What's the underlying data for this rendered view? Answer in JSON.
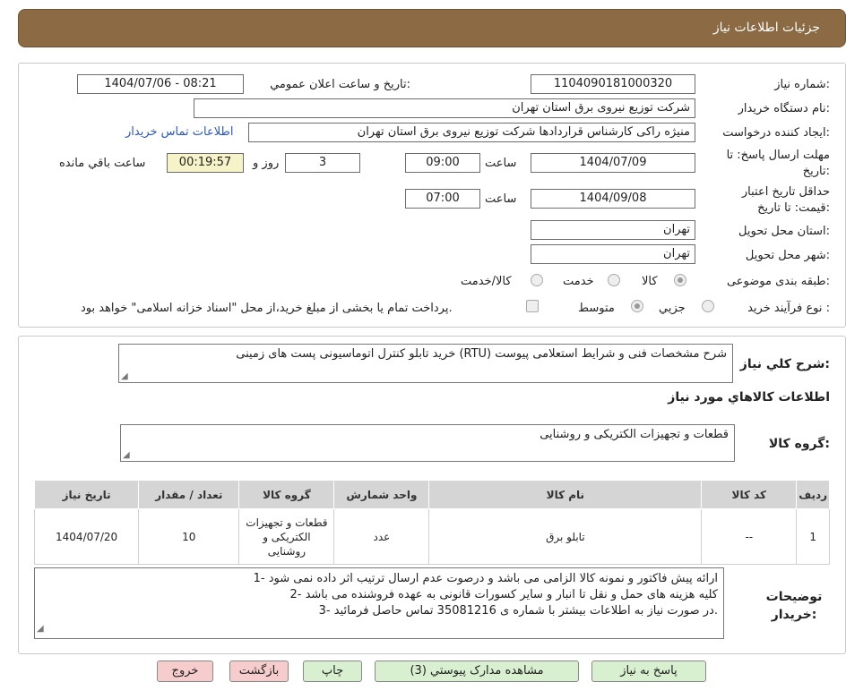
{
  "header": {
    "title": "جزئیات اطلاعات نیاز"
  },
  "fields": {
    "need_number_label": "شماره نیاز:",
    "need_number": "1104090181000320",
    "announce_label": "تاریخ و ساعت اعلان عمومي:",
    "announce_value": "1404/07/06 - 08:21",
    "buyer_org_label": "نام دستگاه خريدار:",
    "buyer_org": "شرکت توزیع نیروی برق استان تهران",
    "creator_label": "ايجاد كننده درخواست:",
    "creator": "منیژه راکی کارشناس قراردادها شرکت توزیع نیروی برق استان تهران",
    "contact_link": "اطلاعات تماس خريدار",
    "deadline_label": "مهلت ارسال پاسخ: تا تاريخ:",
    "deadline_date": "1404/07/09",
    "time_label": "ساعت",
    "deadline_time": "09:00",
    "days": "3",
    "days_label": "روز و",
    "remaining": "00:19:57",
    "remaining_label": "ساعت باقي مانده",
    "validity_label": "حداقل تاريخ اعتبار قيمت: تا تاريخ:",
    "validity_date": "1404/09/08",
    "validity_time_label": "ساعت",
    "validity_time": "07:00",
    "province_label": "استان محل تحويل:",
    "province": "تهران",
    "city_label": "شهر محل تحويل:",
    "city": "تهران",
    "category_label": "طبقه بندی موضوعی:",
    "category_options": [
      "کالا",
      "خدمت",
      "کالا/خدمت"
    ],
    "process_label": "نوع فرآيند خريد :",
    "process_options": [
      "جزيي",
      "متوسط"
    ],
    "process_note": "پرداخت تمام یا بخشی از مبلغ خرید،از محل \"اسناد خزانه اسلامی\" خواهد بود."
  },
  "summary": {
    "label": "شرح كلي نياز:",
    "text": "خرید تابلو کنترل اتوماسیونی پست های زمینی (RTU) شرح مشخصات فنی و شرایط استعلامی پیوست"
  },
  "goods": {
    "section_title": "اطلاعات كالاهاي مورد نياز",
    "group_label": "گروه كالا:",
    "group_value": "قطعات و تجهیزات الکتریکی و روشنایی",
    "columns": [
      "رديف",
      "كد كالا",
      "نام كالا",
      "واحد شمارش",
      "گروه كالا",
      "تعداد / مقدار",
      "تاريخ نياز"
    ],
    "rows": [
      [
        "1",
        "--",
        "تابلو برق",
        "عدد",
        "قطعات و تجهیزات الکتریکی و روشنایی",
        "10",
        "1404/07/20"
      ]
    ]
  },
  "notes": {
    "label": "توضيحات خريدار:",
    "lines": [
      "1- ارائه پیش فاکتور و نمونه کالا الزامی می باشد و درصوت عدم ارسال ترتیب اثر داده نمی شود",
      "2- کلیه هزینه های حمل و نقل تا انبار و سایر کسورات قانونی به عهده فروشنده می باشد",
      "3- در صورت نیاز به اطلاعات بیشتر با شماره ی 35081216 تماس حاصل فرمائید."
    ]
  },
  "buttons": {
    "reply": "پاسخ به نياز",
    "attachments": "مشاهده مدارک پیوستي (3)",
    "print": "چاپ",
    "back": "بازگشت",
    "exit": "خروج"
  },
  "colors": {
    "header": "#8b6a44",
    "green_button": "#d8f0cf",
    "pink_button": "#f6cccc",
    "timer_bg": "#f7f3c8"
  }
}
